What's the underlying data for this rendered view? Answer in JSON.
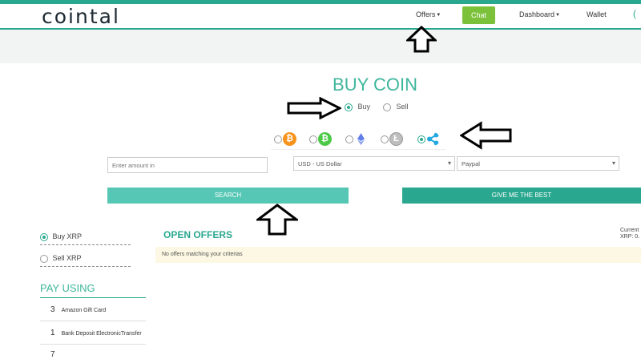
{
  "nav": {
    "logo": "cointal",
    "offers": "Offers",
    "chat": "Chat",
    "dashboard": "Dashboard",
    "wallet": "Wallet"
  },
  "main": {
    "title": "BUY COIN",
    "type_options": [
      {
        "label": "Buy",
        "selected": true
      },
      {
        "label": "Sell",
        "selected": false
      }
    ],
    "coins": [
      {
        "icon": "bitcoin-icon",
        "color": "#f7931a",
        "selected": false
      },
      {
        "icon": "bitcoin-cash-icon",
        "color": "#4cc947",
        "selected": false
      },
      {
        "icon": "ethereum-icon",
        "color": "#627eea",
        "selected": false
      },
      {
        "icon": "litecoin-icon",
        "color": "#bebebe",
        "selected": false
      },
      {
        "icon": "ripple-icon",
        "color": "#23a8e0",
        "selected": true
      }
    ],
    "amount_placeholder": "Enter amount in",
    "currency": "USD - US Dollar",
    "payment": "Paypal",
    "search_label": "SEARCH",
    "best_label": "GIVE ME THE BEST"
  },
  "sidebar": {
    "buy_label": "Buy XRP",
    "sell_label": "Sell XRP",
    "pay_title": "PAY USING",
    "pay_items": [
      {
        "count": "3",
        "label": "Amazon Gift Card"
      },
      {
        "count": "1",
        "label": "Bank Deposit ElectronicTransfer"
      },
      {
        "count": "7",
        "label": ""
      }
    ]
  },
  "offers": {
    "title": "OPEN OFFERS",
    "current_line1": "Current",
    "current_line2": "XRP: 0.",
    "empty_message": "No offers matching your criterias"
  },
  "colors": {
    "accent": "#2aa88f",
    "title_teal": "#3fb69c",
    "chat_green": "#7cc13a",
    "search_btn": "#56c7b4",
    "best_btn": "#2aa88f",
    "notice_bg": "#fcf8e3"
  }
}
